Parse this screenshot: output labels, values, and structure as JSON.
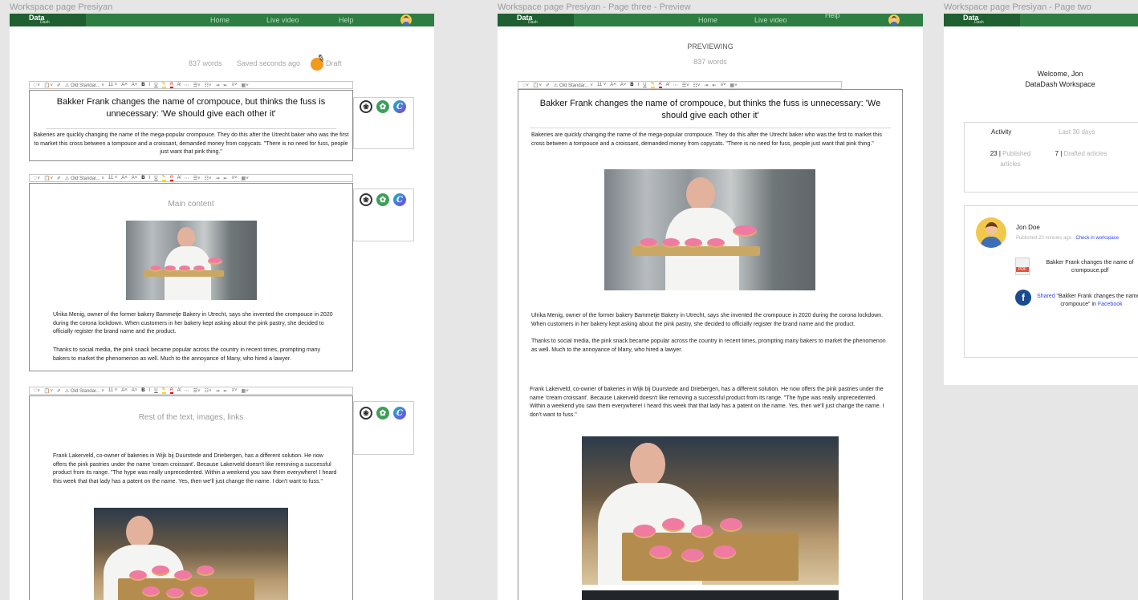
{
  "frames": {
    "left": {
      "title": "Workspace page Presiyan"
    },
    "middle": {
      "title": "Workspace page Presiyan - Page three - Preview"
    },
    "right": {
      "title": "Workspace page Presiyan - Page two"
    }
  },
  "nav": {
    "logo_main": "Data",
    "logo_sub": "Dash",
    "home": "Home",
    "live": "Live video",
    "help": "Help"
  },
  "toolbar": {
    "style_label": "Old Standar...",
    "size_label": "11",
    "bold": "B",
    "italic": "I",
    "underline": "U",
    "font_color": "A",
    "grow": "A˄",
    "shrink": "A˅",
    "more": "⋯"
  },
  "editor_meta": {
    "word_count": "837 words",
    "saved": "Saved seconds ago",
    "status": "Draft"
  },
  "article": {
    "headline": "Bakker Frank changes the name of crompouce, but thinks the fuss is unnecessary: 'We should give each other it'",
    "intro": "Bakeries are quickly changing the name of the mega-popular crompouce. They do this after the Utrecht baker who was the first to market this cross between a tompouce and a croissant, demanded money from copycats. \"There is no need for fuss, people just want that pink thing.\"",
    "para1": "Ulrika Menig, owner of the former bakery Bammetje Bakery in Utrecht, says she invented the crompouce in 2020 during the corona lockdown. When customers in her bakery kept asking about the pink pastry, she decided to officially register the brand name and the product.",
    "para2": "Thanks to social media, the pink snack became popular across the country in recent times, prompting many bakers to market the phenomenon as well. Much to the annoyance of Many, who hired a lawyer.",
    "para3": "Frank Lakerveld, co-owner of bakeries in Wijk bij Duurstede and Driebergen, has a different solution. He now offers the pink pastries under the name 'cream croissant'. Because Lakerveld doesn't like removing a successful product from its range. \"The hype was really unprecedented. Within a weekend you saw them everywhere! I heard this week that that lady has a patent on the name. Yes, then we'll just change the name. I don't want to fuss.\""
  },
  "section_labels": {
    "main": "Main content",
    "rest": "Rest of the text, images, links"
  },
  "preview": {
    "label": "PREVIEWING",
    "word_count": "837 words"
  },
  "page_two": {
    "welcome": "Welcome, Jon",
    "workspace": "DataDash Workspace",
    "activity_label": "Activity",
    "period_label": "Last 30 days",
    "published_count": "23",
    "published_label": "Published articles",
    "drafted_count": "7",
    "drafted_label": "Drafted articles",
    "user_name": "Jon Doe",
    "published_meta": "Published 20 minutes ago",
    "check_link": "Check in workspace",
    "pdf_name": "Bakker Frank changes the name of crompouce.pdf",
    "pdf_badge": "PDF",
    "shared_word": "Shared",
    "shared_text": "\"Bakker Frank changes the name of crompouce\" in",
    "facebook": "Facebook",
    "facebook_glyph": "f"
  },
  "icons": {
    "gpt_glyph": "❀",
    "copilot_glyph": "✿",
    "canva_glyph": "C"
  },
  "colors": {
    "nav_green": "#2e7d43",
    "logo_green": "#1f5f31",
    "draft_orange": "#f39a1e",
    "link_blue": "#3344ee",
    "facebook_blue": "#1b4b8f"
  }
}
